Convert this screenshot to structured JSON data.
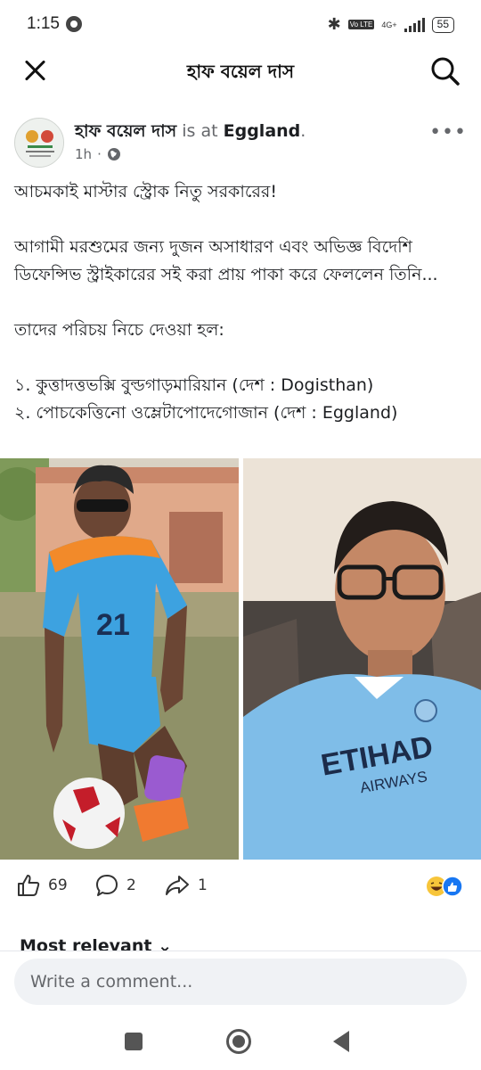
{
  "status_bar": {
    "time": "1:15",
    "network_label": "4G+",
    "volte_label": "Vo LTE",
    "battery": "55"
  },
  "header": {
    "title": "হাফ বয়েল দাস"
  },
  "post": {
    "author_name": "হাফ বয়েল দাস",
    "connector": "is at",
    "place": "Eggland",
    "place_suffix": ".",
    "time": "1h",
    "time_sep": "·",
    "lines": {
      "l1": "আচমকাই মাস্টার স্ট্রোক নিতু সরকারের!",
      "l2": "আগামী মরশুমের জন্য দুজন অসাধারণ এবং অভিজ্ঞ বিদেশি ডিফেন্সিভ স্ট্রাইকারের সই করা প্রায় পাকা করে ফেললেন তিনি...",
      "l3": "তাদের পরিচয় নিচে দেওয়া হল:",
      "l4": "১. কুত্তাদত্তভক্সি বুল্ডগাড়মারিয়ান (দেশ : Dogisthan)",
      "l5": "২. পোচকেত্তিনো ওম্লেটাপোদেগোজান (দেশ : Eggland)"
    },
    "jersey_number": "21",
    "jersey_sponsor_1": "ETIHAD",
    "jersey_sponsor_2": "AIRWAYS"
  },
  "reactions": {
    "likes": "69",
    "comments": "2",
    "shares": "1"
  },
  "sort_label": "Most relevant",
  "comment_box": {
    "placeholder": "Write a comment..."
  },
  "colors": {
    "fb_blue": "#1877f2",
    "text": "#1c1e21",
    "secondary": "#65676b",
    "jersey_blue": "#3da2e0",
    "jersey_orange": "#f28a2a",
    "city_blue": "#7fbde8"
  }
}
